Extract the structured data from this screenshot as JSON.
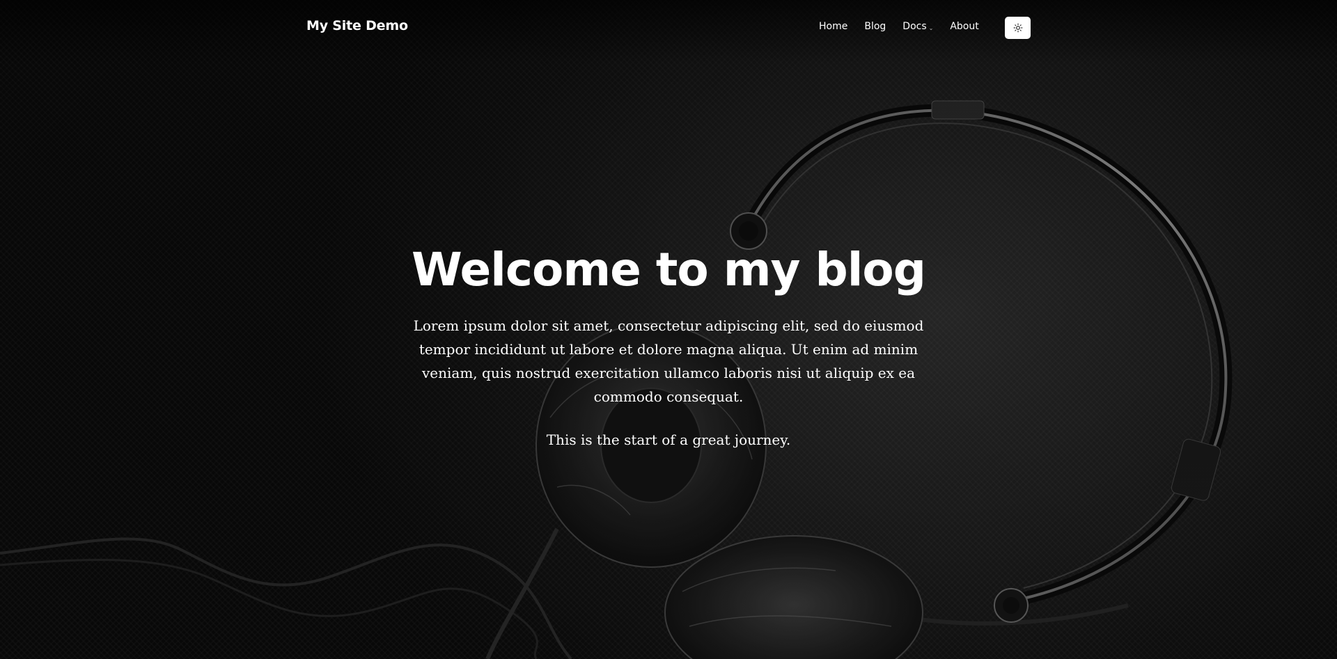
{
  "site": {
    "brand": "My Site Demo"
  },
  "nav": {
    "items": [
      {
        "label": "Home"
      },
      {
        "label": "Blog"
      },
      {
        "label": "Docs",
        "has_dropdown": true
      },
      {
        "label": "About"
      }
    ],
    "theme_toggle_icon": "sun-icon"
  },
  "hero": {
    "title": "Welcome to my blog",
    "lead": "Lorem ipsum dolor sit amet, consectetur adipiscing elit, sed do eiusmod tempor incididunt ut labore et dolore magna aliqua. Ut enim ad minim veniam, quis nostrud exercitation ullamco laboris nisi ut aliquip ex ea commodo consequat.",
    "subtitle": "This is the start of a great journey.",
    "background_image": "headphones-photo"
  },
  "colors": {
    "text": "#ffffff",
    "background": "#111111",
    "toggle_bg": "#ffffff"
  }
}
